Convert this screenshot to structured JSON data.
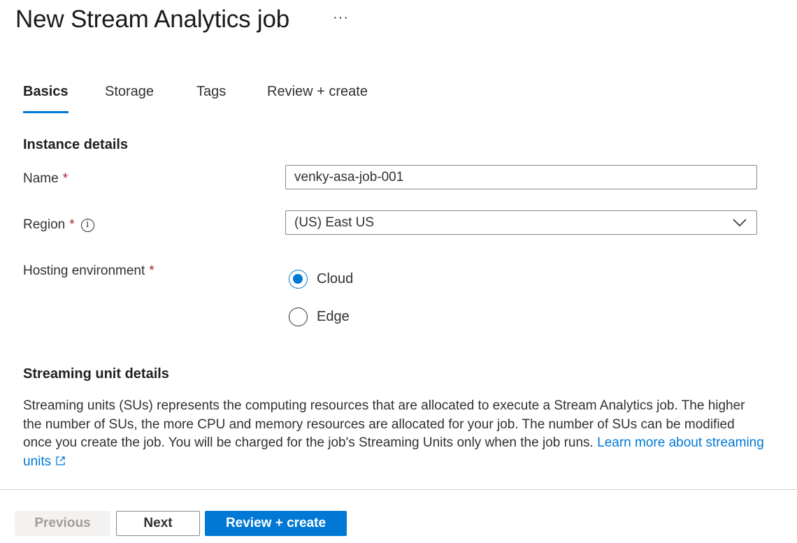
{
  "header": {
    "title": "New Stream Analytics job",
    "more_label": "···"
  },
  "tabs": [
    {
      "label": "Basics",
      "active": true
    },
    {
      "label": "Storage",
      "active": false
    },
    {
      "label": "Tags",
      "active": false
    },
    {
      "label": "Review + create",
      "active": false
    }
  ],
  "instance": {
    "heading": "Instance details",
    "name_label": "Name",
    "name_value": "venky-asa-job-001",
    "region_label": "Region",
    "region_value": "(US) East US",
    "hosting_label": "Hosting environment",
    "required_marker": "*",
    "info_glyph": "i",
    "hosting_options": [
      {
        "label": "Cloud",
        "selected": true
      },
      {
        "label": "Edge",
        "selected": false
      }
    ]
  },
  "streaming": {
    "heading": "Streaming unit details",
    "description": "Streaming units (SUs) represents the computing resources that are allocated to execute a Stream Analytics job. The higher the number of SUs, the more CPU and memory resources are allocated for your job. The number of SUs can be modified once you create the job. You will be charged for the job's Streaming Units only when the job runs. ",
    "link_text": "Learn more about streaming units"
  },
  "footer": {
    "previous_label": "Previous",
    "next_label": "Next",
    "create_label": "Review + create"
  },
  "colors": {
    "accent": "#0078d4",
    "required": "#a4262c",
    "disabled_text": "#a19f9d"
  },
  "icons": {
    "more": "more-ellipsis-icon",
    "info": "info-icon",
    "dropdown": "chevron-down-icon",
    "external": "external-link-icon"
  }
}
